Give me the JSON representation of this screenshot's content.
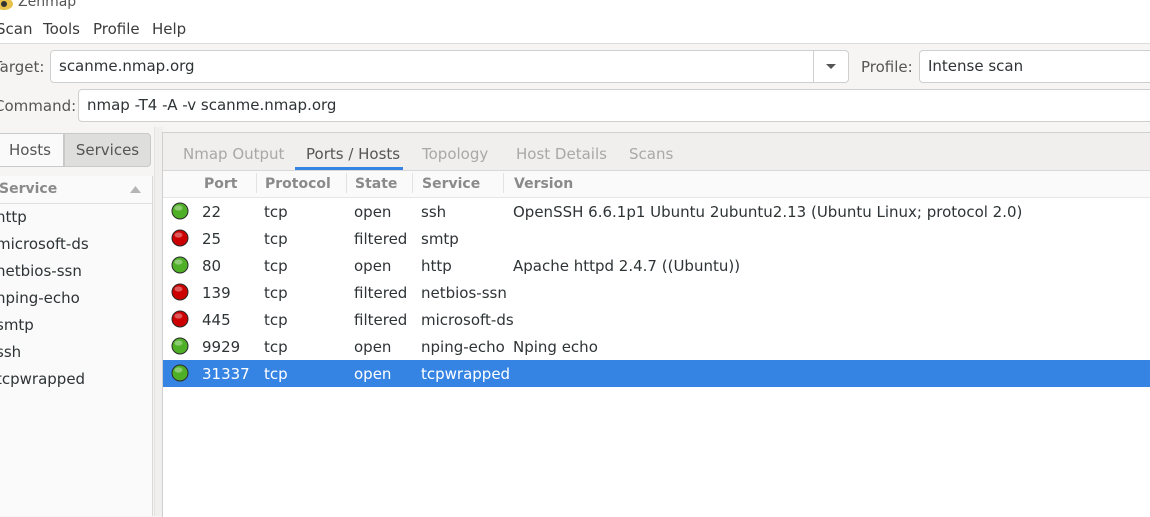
{
  "window": {
    "title": "Zenmap"
  },
  "menu": [
    "Scan",
    "Tools",
    "Profile",
    "Help"
  ],
  "target": {
    "label": "Target:",
    "value": "scanme.nmap.org"
  },
  "profile": {
    "label": "Profile:",
    "value": "Intense scan"
  },
  "command": {
    "label": "Command:",
    "value": "nmap -T4 -A -v scanme.nmap.org"
  },
  "toggles": {
    "hosts": "Hosts",
    "services": "Services"
  },
  "service_list": {
    "header": "Service",
    "items": [
      "http",
      "microsoft-ds",
      "netbios-ssn",
      "nping-echo",
      "smtp",
      "ssh",
      "tcpwrapped"
    ]
  },
  "tabs": [
    "Nmap Output",
    "Ports / Hosts",
    "Topology",
    "Host Details",
    "Scans"
  ],
  "active_tab": "Ports / Hosts",
  "columns": [
    "Port",
    "Protocol",
    "State",
    "Service",
    "Version"
  ],
  "rows": [
    {
      "port": "22",
      "protocol": "tcp",
      "state": "open",
      "service": "ssh",
      "version": "OpenSSH 6.6.1p1 Ubuntu 2ubuntu2.13 (Ubuntu Linux; protocol 2.0)"
    },
    {
      "port": "25",
      "protocol": "tcp",
      "state": "filtered",
      "service": "smtp",
      "version": ""
    },
    {
      "port": "80",
      "protocol": "tcp",
      "state": "open",
      "service": "http",
      "version": "Apache httpd 2.4.7 ((Ubuntu))"
    },
    {
      "port": "139",
      "protocol": "tcp",
      "state": "filtered",
      "service": "netbios-ssn",
      "version": ""
    },
    {
      "port": "445",
      "protocol": "tcp",
      "state": "filtered",
      "service": "microsoft-ds",
      "version": ""
    },
    {
      "port": "9929",
      "protocol": "tcp",
      "state": "open",
      "service": "nping-echo",
      "version": "Nping echo"
    },
    {
      "port": "31337",
      "protocol": "tcp",
      "state": "open",
      "service": "tcpwrapped",
      "version": ""
    }
  ],
  "selected_row": 6,
  "colors": {
    "accent": "#3584e4",
    "open": "#4fb027",
    "filtered": "#cc0000"
  }
}
